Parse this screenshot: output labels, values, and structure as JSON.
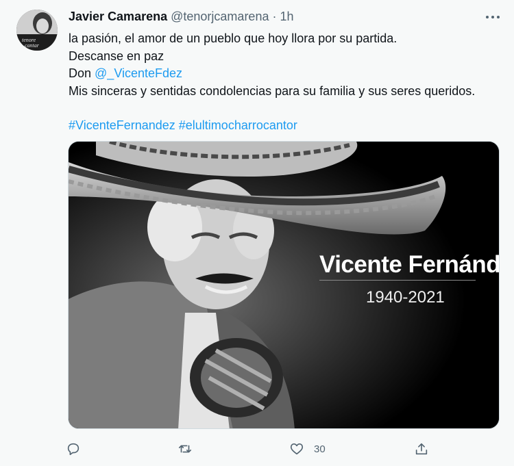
{
  "tweet": {
    "author_name": "Javier Camarena",
    "author_handle": "@tenorjcamarena",
    "separator": "·",
    "timestamp": "1h",
    "avatar_text_1": "tenore",
    "avatar_text_2": "cantar",
    "lines": [
      "la pasión, el amor de un pueblo que hoy llora por su partida.",
      "Descanse en paz",
      "Don ",
      "Mis sinceras y sentidas condolencias para su familia y sus seres queridos."
    ],
    "mention": "@_VicenteFdez",
    "hashtags": "#VicenteFernandez #elultimocharrocantor",
    "media": {
      "caption_name": "Vicente Fernández",
      "caption_years": "1940-2021"
    },
    "actions": {
      "reply_icon": "reply-icon",
      "retweet_icon": "retweet-icon",
      "like_icon": "heart-icon",
      "like_count": "30",
      "share_icon": "share-icon"
    }
  },
  "colors": {
    "background": "#f7f9f9",
    "text": "#0f1419",
    "secondary": "#536471",
    "link": "#1d9bf0"
  }
}
